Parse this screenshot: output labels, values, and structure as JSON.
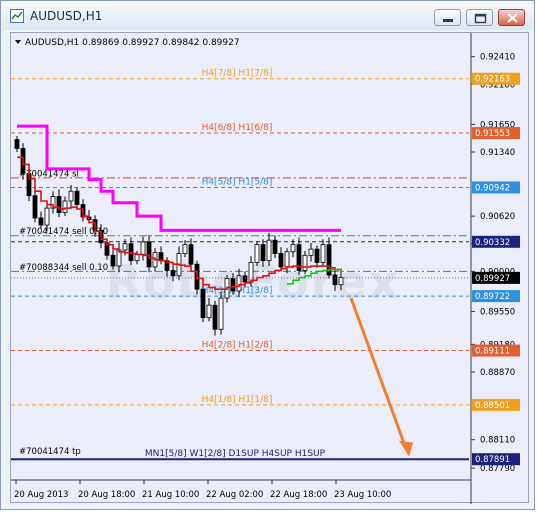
{
  "window": {
    "title": "AUDUSD,H1"
  },
  "chart_header": {
    "text": "AUDUSD,H1  0.89869 0.89927 0.89842 0.89927"
  },
  "colors": {
    "background": "#ecedfa",
    "grid": "#c9cce0",
    "candle": "#000000",
    "ma_red": "#e01010",
    "ma_magenta": "#ff00ff",
    "ma_green": "#00cc00",
    "arrow": "#f08030",
    "orange_level": "#f0a020",
    "red_level": "#e06030",
    "blue_level": "#3090e0",
    "navy_level": "#1a237e"
  },
  "levels": [
    {
      "label": "H4[7/8] H1[7/8]",
      "price_tag": "0.92163",
      "color": "#f0a020"
    },
    {
      "label": "H4[6/8] H1[6/8]",
      "price_tag": "0.91553",
      "color": "#e06030"
    },
    {
      "label": "H4[5/8] H1[5/8]",
      "price_tag": "0.90942",
      "color": "#3090e0"
    },
    {
      "label": "H4[4/8] H4PIVOT H1[4/8]",
      "price_tag": "0.90332",
      "color": "#1a237e"
    },
    {
      "label": "H4[3/8] H1[3/8]",
      "price_tag": "0.89722",
      "color": "#3090e0"
    },
    {
      "label": "H4[2/8] H1[2/8]",
      "price_tag": "0.89111",
      "color": "#e06030"
    },
    {
      "label": "H4[1/8] H1[1/8]",
      "price_tag": "0.88501",
      "color": "#f0a020"
    },
    {
      "label": "MN1[5/8] W1[2/8] D1SUP H4SUP H1SUP",
      "price_tag": "0.87891",
      "color": "#1a237e"
    }
  ],
  "current_price_tag": "0.89927",
  "orders": [
    {
      "text": "#70041474 sl"
    },
    {
      "text": "#70041474 sell 0.10"
    },
    {
      "text": "#70088344 sell 0.10"
    },
    {
      "text": "#70041474 tp"
    }
  ],
  "price_axis": [
    "0.92410",
    "0.92100",
    "0.91650",
    "0.91340",
    "0.90620",
    "0.90310",
    "0.90000",
    "0.89550",
    "0.89180",
    "0.88870",
    "0.88110",
    "0.87790"
  ],
  "time_axis": [
    "20 Aug 2013",
    "20 Aug 18:00",
    "21 Aug 10:00",
    "22 Aug 02:00",
    "22 Aug 18:00",
    "23 Aug 10:00"
  ],
  "watermark": "RoboForex",
  "chart_data": {
    "type": "candlestick",
    "symbol": "AUDUSD",
    "timeframe": "H1",
    "ohlc_last": {
      "open": 0.89869,
      "high": 0.89927,
      "low": 0.89842,
      "close": 0.89927
    },
    "ylim": [
      0.8768,
      0.9262
    ],
    "y_ticks": [
      0.9241,
      0.921,
      0.9165,
      0.9134,
      0.9062,
      0.9031,
      0.9,
      0.8955,
      0.8918,
      0.8887,
      0.8811,
      0.8779
    ],
    "x_tick_labels": [
      "20 Aug 2013",
      "20 Aug 18:00",
      "21 Aug 10:00",
      "22 Aug 02:00",
      "22 Aug 18:00",
      "23 Aug 10:00"
    ],
    "close_series": [
      0.9138,
      0.911,
      0.9085,
      0.906,
      0.9052,
      0.9071,
      0.9084,
      0.9066,
      0.9079,
      0.909,
      0.9075,
      0.9061,
      0.9058,
      0.9046,
      0.9032,
      0.9018,
      0.9006,
      0.9024,
      0.9031,
      0.9012,
      0.9019,
      0.9033,
      0.9005,
      0.9021,
      0.9012,
      0.9001,
      0.8995,
      0.902,
      0.903,
      0.9008,
      0.898,
      0.8948,
      0.8962,
      0.8935,
      0.897,
      0.8992,
      0.8978,
      0.8995,
      0.8988,
      0.901,
      0.903,
      0.9012,
      0.9035,
      0.902,
      0.9005,
      0.9022,
      0.903,
      0.9001,
      0.9018,
      0.9025,
      0.901,
      0.903,
      0.8996,
      0.8985,
      0.8993
    ],
    "moving_averages": [
      {
        "color": "red",
        "values": [
          0.9128,
          0.912,
          0.9104,
          0.909,
          0.9079,
          0.9075,
          0.9072,
          0.907,
          0.9071,
          0.9072,
          0.907,
          0.9062,
          0.9055,
          0.9045,
          0.9036,
          0.903,
          0.9025,
          0.9022,
          0.9021,
          0.902,
          0.9019,
          0.9018,
          0.9015,
          0.9013,
          0.9012,
          0.901,
          0.9008,
          0.9007,
          0.9006,
          0.9,
          0.8992,
          0.8985,
          0.8982,
          0.898,
          0.898,
          0.8982,
          0.8983,
          0.8985,
          0.8987,
          0.899,
          0.8993,
          0.8995,
          0.8998,
          0.9001,
          0.9003,
          0.9005,
          0.9006,
          0.9005,
          0.9005,
          0.9006,
          0.9006,
          0.9006,
          0.9004,
          0.9002,
          0.9
        ]
      },
      {
        "color": "magenta",
        "values": [
          0.9163,
          0.9163,
          0.9163,
          0.9163,
          0.9163,
          0.9115,
          0.9115,
          0.9115,
          0.9115,
          0.9115,
          0.9115,
          0.9115,
          0.9103,
          0.9103,
          0.909,
          0.909,
          0.9077,
          0.9077,
          0.9077,
          0.9077,
          0.9062,
          0.9062,
          0.9062,
          0.9062,
          0.9046,
          0.9046,
          0.9046,
          0.9046,
          0.9046,
          0.9046,
          0.9046,
          0.9046,
          0.9046,
          0.9046,
          0.9046,
          0.9046,
          0.9046,
          0.9046,
          0.9046,
          0.9046,
          0.9046,
          0.9046,
          0.9046,
          0.9046,
          0.9046,
          0.9046,
          0.9046,
          0.9046,
          0.9046,
          0.9046,
          0.9046,
          0.9046,
          0.9046,
          0.9046,
          0.9046
        ]
      },
      {
        "color": "green",
        "values": [
          0.8986,
          0.899,
          0.8993,
          0.8995,
          0.8998,
          0.9,
          0.9001,
          0.9002,
          0.9002,
          0.9001
        ]
      }
    ]
  }
}
